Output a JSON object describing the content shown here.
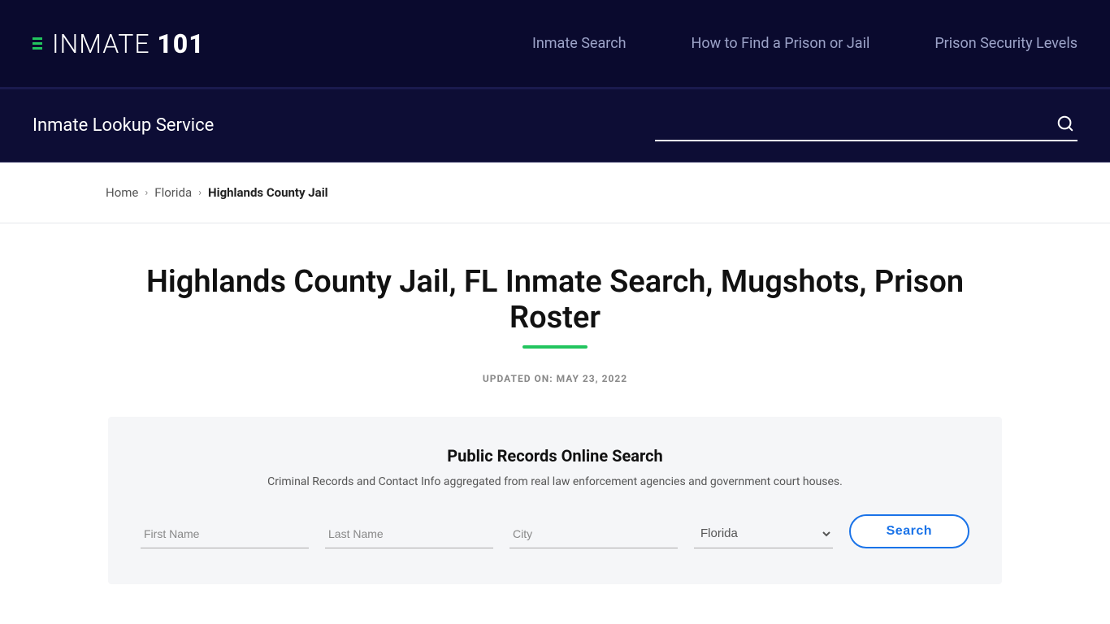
{
  "nav": {
    "logo_text": "INMATE 101",
    "logo_inmate": "INMATE ",
    "logo_num": "101",
    "links": [
      {
        "label": "Inmate Search",
        "href": "#"
      },
      {
        "label": "How to Find a Prison or Jail",
        "href": "#"
      },
      {
        "label": "Prison Security Levels",
        "href": "#"
      }
    ]
  },
  "search_section": {
    "service_label": "Inmate Lookup Service",
    "input_placeholder": ""
  },
  "breadcrumb": {
    "home": "Home",
    "state": "Florida",
    "current": "Highlands County Jail"
  },
  "main": {
    "page_title": "Highlands County Jail, FL Inmate Search, Mugshots, Prison Roster",
    "updated_label": "UPDATED ON: MAY 23, 2022"
  },
  "search_box": {
    "title": "Public Records Online Search",
    "subtitle": "Criminal Records and Contact Info aggregated from real law enforcement agencies and government court houses.",
    "first_name_placeholder": "First Name",
    "last_name_placeholder": "Last Name",
    "city_placeholder": "City",
    "state_default": "Florida",
    "search_button": "Search"
  }
}
